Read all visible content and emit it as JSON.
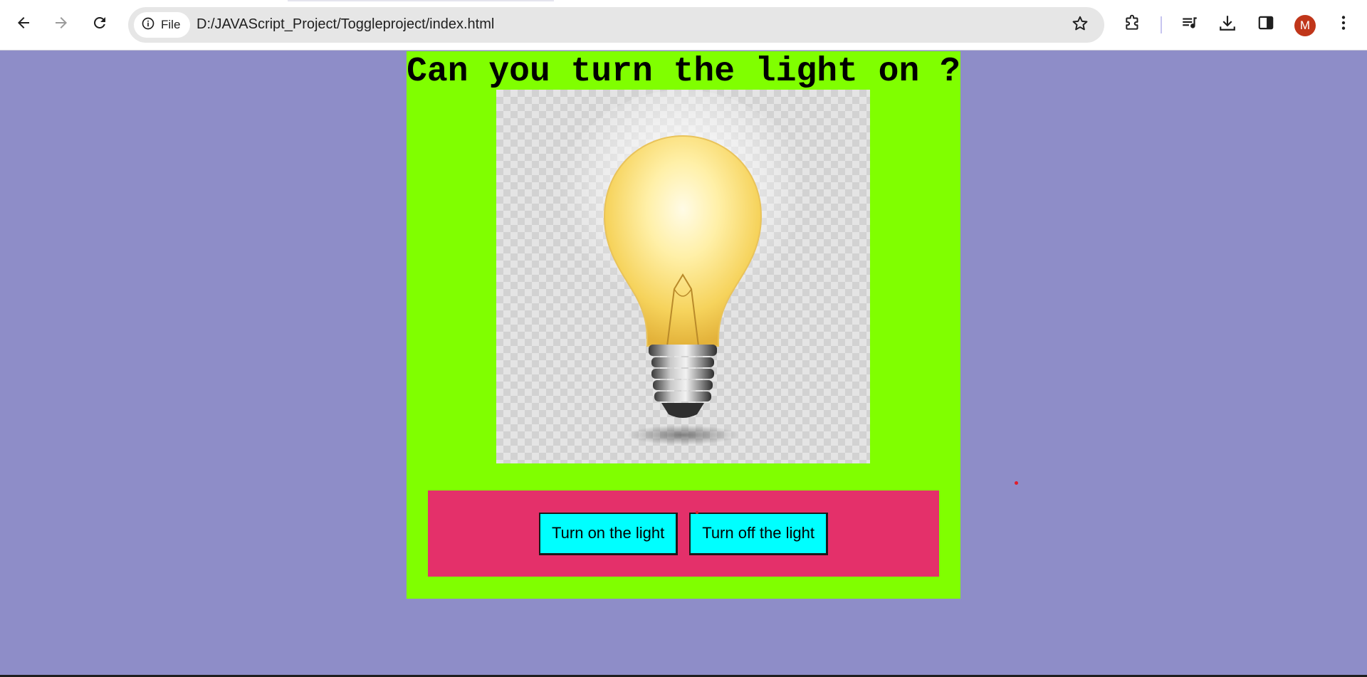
{
  "browser": {
    "site_chip_label": "File",
    "url": "D:/JAVAScript_Project/Toggleproject/index.html",
    "profile_initial": "M",
    "icons": {
      "back": "arrow-left-icon",
      "forward": "arrow-right-icon",
      "reload": "reload-icon",
      "site_info": "info-circle-icon",
      "bookmark": "star-icon",
      "extensions": "puzzle-piece-icon",
      "media": "media-queue-icon",
      "downloads": "download-icon",
      "side_panel": "side-panel-icon",
      "menu": "kebab-menu-icon"
    }
  },
  "page": {
    "heading": "Can you turn the light on ?",
    "image": "light-bulb-on",
    "buttons": {
      "on_label": "Turn on the light",
      "off_label": "Turn off the light"
    },
    "colors": {
      "page_background": "#8e8dc8",
      "card_background": "#80ff00",
      "button_panel": "#e4306a",
      "button_fill": "#00ffff"
    }
  }
}
